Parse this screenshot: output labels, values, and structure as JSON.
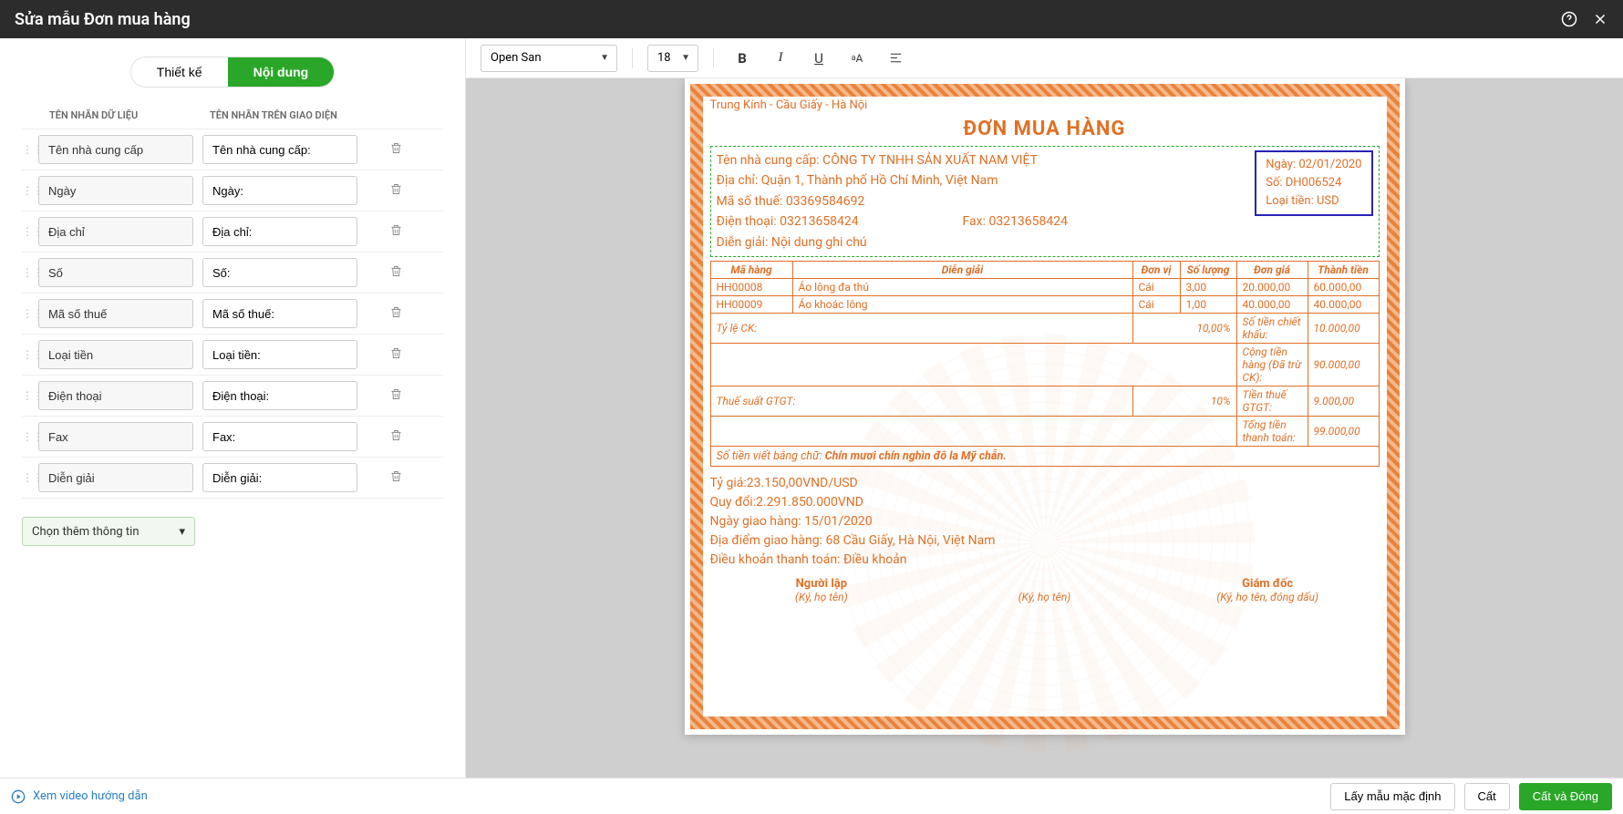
{
  "header": {
    "title": "Sửa mẫu Đơn mua hàng"
  },
  "tabs": {
    "design": "Thiết kế",
    "content": "Nội dung"
  },
  "columns": {
    "data_label": "TÊN NHÃN DỮ LIỆU",
    "ui_label": "TÊN NHÃN TRÊN GIAO DIỆN"
  },
  "fields": [
    {
      "data": "Tên nhà cung cấp",
      "ui": "Tên nhà cung cấp:"
    },
    {
      "data": "Ngày",
      "ui": "Ngày:"
    },
    {
      "data": "Địa chỉ",
      "ui": "Địa chỉ:"
    },
    {
      "data": "Số",
      "ui": "Số:"
    },
    {
      "data": "Mã số thuế",
      "ui": "Mã số thuế:"
    },
    {
      "data": "Loại tiền",
      "ui": "Loại tiền:"
    },
    {
      "data": "Điện thoại",
      "ui": "Điện thoại:"
    },
    {
      "data": "Fax",
      "ui": "Fax:"
    },
    {
      "data": "Diễn giải",
      "ui": "Diễn giải:"
    }
  ],
  "add_more": "Chọn thêm thông tin",
  "toolbar": {
    "font": "Open San",
    "size": "18"
  },
  "doc": {
    "address_line": "Trung Kính - Cầu Giấy - Hà Nội",
    "title": "ĐƠN MUA HÀNG",
    "supplier_label": "Tên nhà cung cấp:",
    "supplier_value": "CÔNG TY TNHH SẢN XUẤT NAM VIỆT",
    "address_label": "Địa chỉ:",
    "address_value": "Quận 1, Thành phố Hồ Chí Minh, Việt Nam",
    "tax_label": "Mã số thuế:",
    "tax_value": "03369584692",
    "phone_label": "Điện thoại:",
    "phone_value": "03213658424",
    "fax_label": "Fax:",
    "fax_value": "03213658424",
    "note_label": "Diễn giải:",
    "note_value": "Nội dung ghi chú",
    "date_label": "Ngày:",
    "date_value": "02/01/2020",
    "no_label": "Số:",
    "no_value": "DH006524",
    "currency_label": "Loại tiền:",
    "currency_value": "USD",
    "cols": {
      "sku": "Mã hàng",
      "desc": "Diễn giải",
      "unit": "Đơn vị",
      "qty": "Số lượng",
      "price": "Đơn giá",
      "amount": "Thành tiền"
    },
    "lines": [
      {
        "sku": "HH00008",
        "desc": "Áo lông đa thú",
        "unit": "Cái",
        "qty": "3,00",
        "price": "20.000,00",
        "amount": "60.000,00"
      },
      {
        "sku": "HH00009",
        "desc": "Áo khoác lông",
        "unit": "Cái",
        "qty": "1,00",
        "price": "40.000,00",
        "amount": "40.000,00"
      }
    ],
    "discount_rate_lbl": "Tỷ lệ CK:",
    "discount_rate_val": "10,00%",
    "discount_amt_lbl": "Số tiền chiết khấu:",
    "discount_amt_val": "10.000,00",
    "subtotal_lbl": "Cộng tiền hàng (Đã trừ CK):",
    "subtotal_val": "90.000,00",
    "vat_rate_lbl": "Thuế suất GTGT:",
    "vat_rate_val": "10%",
    "vat_amt_lbl": "Tiền thuế GTGT:",
    "vat_amt_val": "9.000,00",
    "total_lbl": "Tổng tiền thanh toán:",
    "total_val": "99.000,00",
    "words_lbl": "Số tiền viết bằng chữ:",
    "words_val": "Chín mươi chín nghìn đô la Mỹ chẵn.",
    "rate_line": "Tỷ giá:23.150,00VND/USD",
    "converted_line": "Quy đổi:2.291.850.000VND",
    "delivery_date": "Ngày giao hàng: 15/01/2020",
    "delivery_place": "Địa điểm giao hàng: 68 Cầu Giấy, Hà Nội, Việt Nam",
    "payment_terms": "Điều khoản thanh toán: Điều khoản",
    "sig_left_title": "Người lập",
    "sig_left_note": "(Ký, họ tên)",
    "sig_mid_note": "(Ký, họ tên)",
    "sig_right_title": "Giám đốc",
    "sig_right_note": "(Ký, họ tên, đóng dấu)"
  },
  "footer": {
    "video_link": "Xem video hướng dẫn",
    "default": "Lấy mẫu mặc định",
    "save": "Cất",
    "save_close": "Cất và Đóng"
  }
}
